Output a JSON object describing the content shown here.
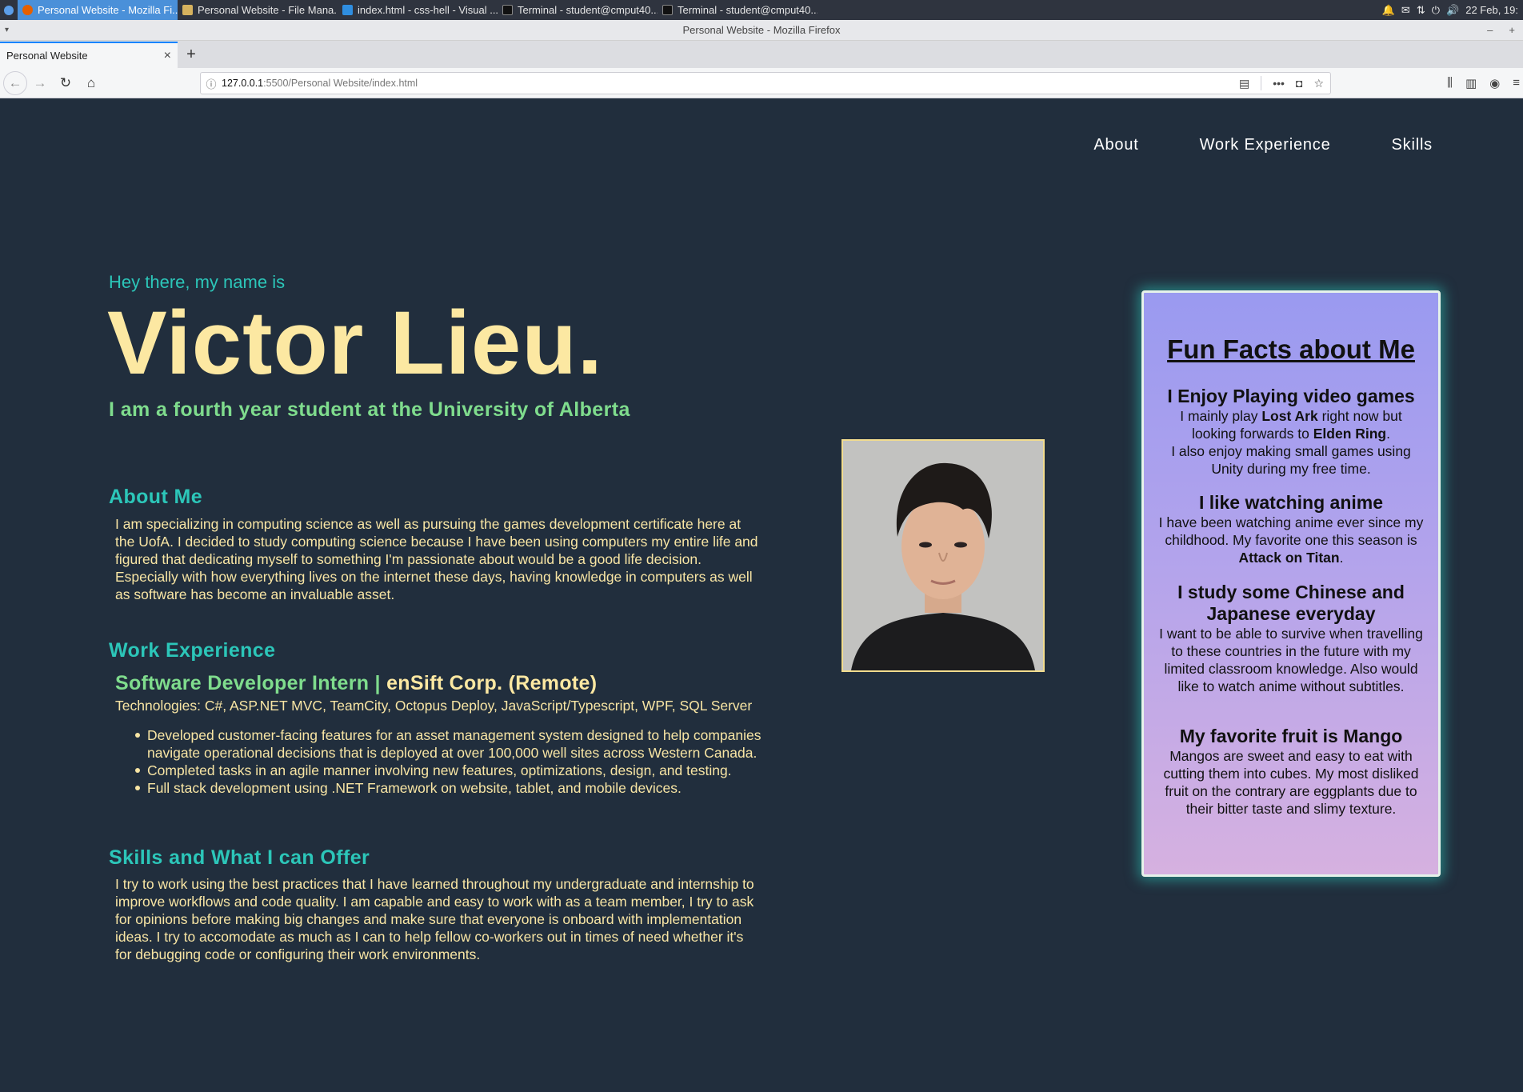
{
  "taskbar": {
    "tasks": [
      "Personal Website - Mozilla Fi...",
      "Personal Website - File Mana...",
      "index.html - css-hell - Visual ...",
      "Terminal - student@cmput40...",
      "Terminal - student@cmput40..."
    ],
    "clock": "22 Feb, 19:"
  },
  "window": {
    "title": "Personal Website - Mozilla Firefox"
  },
  "browser": {
    "tab_title": "Personal Website",
    "url_host": "127.0.0.1",
    "url_path": ":5500/Personal Website/index.html"
  },
  "site": {
    "nav": [
      "About",
      "Work Experience",
      "Skills"
    ],
    "greeting": "Hey there, my name is",
    "name": "Victor Lieu.",
    "tagline": "I am a fourth year student at the University of Alberta",
    "about": {
      "title": "About Me",
      "body": "I am specializing in computing science as well as pursuing the games development certificate here at the UofA. I decided to study computing science because I have been using computers my entire life and figured that dedicating myself to something I'm passionate about would be a good life decision. Especially with how everything lives on the internet these days, having knowledge in computers as well as software has become an invaluable asset."
    },
    "work": {
      "title": "Work Experience",
      "role": "Software Developer Intern |",
      "company": "enSift Corp. (Remote)",
      "tech": "Technologies: C#, ASP.NET MVC, TeamCity, Octopus Deploy, JavaScript/Typescript, WPF, SQL Server",
      "bullets": [
        "Developed customer-facing features for an asset management system designed to help companies navigate operational decisions that is deployed at over 100,000 well sites across Western Canada.",
        "Completed tasks in an agile manner involving new features, optimizations, design, and testing.",
        "Full stack development using .NET Framework on website, tablet, and mobile devices."
      ]
    },
    "skills": {
      "title": "Skills and What I can Offer",
      "body": "I try to work using the best practices that I have learned throughout my undergraduate and internship to improve workflows and code quality. I am capable and easy to work with as a team member, I try to ask for opinions before making big changes and make sure that everyone is onboard with implementation ideas. I try to accomodate as much as I can to help fellow co-workers out in times of need whether it's for debugging code or configuring their work environments."
    },
    "fun_facts": {
      "title": "Fun Facts about Me",
      "facts": [
        {
          "heading": "I Enjoy Playing video games",
          "p1": "I mainly play ",
          "b1": "Lost Ark",
          "p2": " right now but looking forwards to ",
          "b2": "Elden Ring",
          "p3": ".",
          "p4": "I also enjoy making small games using Unity during my free time."
        },
        {
          "heading": "I like watching anime",
          "p1": "I have been watching anime ever since my childhood. My favorite one this season is ",
          "b1": "Attack on Titan",
          "p2": "."
        },
        {
          "heading": "I study some Chinese and Japanese everyday",
          "p1": "I want to be able to survive when travelling to these countries in the future with my limited classroom knowledge. Also would like to watch anime without subtitles."
        },
        {
          "heading": "My favorite fruit is Mango",
          "p1": "Mangos are sweet and easy to eat with cutting them into cubes. My most disliked fruit on the contrary are eggplants due to their bitter taste and slimy texture."
        }
      ]
    }
  },
  "colors": {
    "page_bg": "#212e3d",
    "accent_teal": "#2cc6b9",
    "accent_green": "#7fdc8d",
    "name_yellow": "#fce8a2",
    "text_cream": "#f8e5a4"
  }
}
